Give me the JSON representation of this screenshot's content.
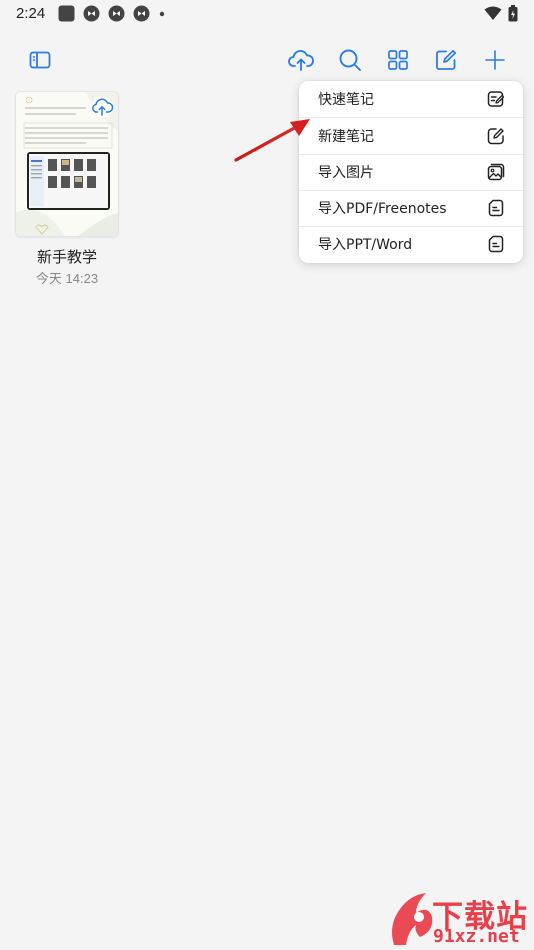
{
  "status_bar": {
    "time": "2:24",
    "icons": [
      "stop-icon",
      "sync-icon",
      "sync-icon",
      "sync-icon",
      "dot-icon"
    ],
    "right_icons": [
      "wifi-icon",
      "battery-icon"
    ]
  },
  "toolbar": {
    "sidebar_toggle_icon": "sidebar-icon",
    "cloud_sync_icon": "cloud-upload-icon",
    "search_icon": "search-icon",
    "grid_view_icon": "grid-icon",
    "edit_icon": "edit-icon",
    "add_icon": "plus-icon",
    "accent_color": "#2b7de1"
  },
  "notes": [
    {
      "title": "新手教学",
      "date": "今天 14:23"
    }
  ],
  "menu": {
    "items": [
      {
        "label": "快速笔记",
        "icon": "quick-note-icon"
      },
      {
        "label": "新建笔记",
        "icon": "new-note-icon"
      },
      {
        "label": "导入图片",
        "icon": "image-icon"
      },
      {
        "label": "导入PDF/Freenotes",
        "icon": "pdf-file-icon"
      },
      {
        "label": "导入PPT/Word",
        "icon": "ppt-file-icon"
      }
    ]
  },
  "watermark": {
    "text_cn": "下载站",
    "text_domain": "91xz.net",
    "color": "#e8404a"
  }
}
